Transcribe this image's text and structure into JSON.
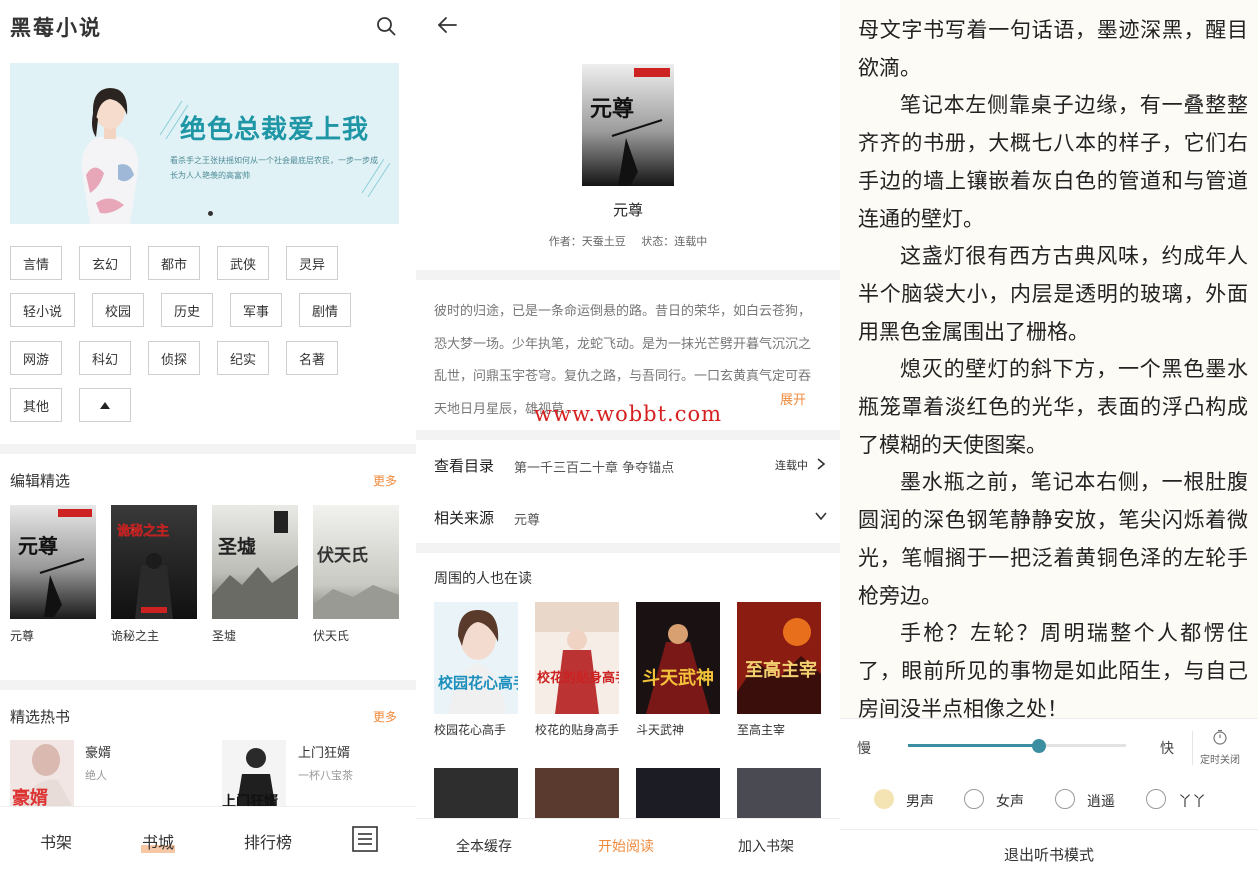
{
  "bookstore": {
    "app_title": "黑莓小说",
    "banner": {
      "title": "绝色总裁爱上我",
      "subtitle": "看杀手之王张扶摇如何从一个社会最底层农民，一步一步成长为人人艳羡的高富帅"
    },
    "categories": [
      "言情",
      "玄幻",
      "都市",
      "武侠",
      "灵异",
      "轻小说",
      "校园",
      "历史",
      "军事",
      "剧情",
      "网游",
      "科幻",
      "侦探",
      "纪实",
      "名著",
      "其他"
    ],
    "editor_picks": {
      "title": "编辑精选",
      "more": "更多",
      "books": [
        {
          "name": "元尊",
          "cover_text": "元尊"
        },
        {
          "name": "诡秘之主",
          "cover_text": "诡秘之主"
        },
        {
          "name": "圣墟",
          "cover_text": "圣墟"
        },
        {
          "name": "伏天氏",
          "cover_text": "伏天氏"
        }
      ]
    },
    "hot_books": {
      "title": "精选热书",
      "more": "更多",
      "books": [
        {
          "name": "豪婿",
          "author": "绝人",
          "cover_text": "豪婿"
        },
        {
          "name": "上门狂婿",
          "author": "一杯八宝茶",
          "cover_text": "上门狂婿"
        }
      ]
    },
    "bottom_nav": [
      "书架",
      "书城",
      "排行榜"
    ]
  },
  "detail": {
    "book_name": "元尊",
    "cover_text": "元尊",
    "author": "作者：天蚕土豆",
    "status": "状态：连载中",
    "intro": "彼时的归途，已是一条命运倒悬的路。昔日的荣华，如白云苍狗，恐大梦一场。少年执笔，龙蛇飞动。是为一抹光芒劈开暮气沉沉之乱世，问鼎玉宇苍穹。复仇之路，与吾同行。一口玄黄真气定可吞天地日月星辰，雄视草..",
    "intro_more": "展开",
    "catalog": {
      "label": "查看目录",
      "value": "第一千三百二十章 争夺锚点",
      "status": "连载中"
    },
    "source": {
      "label": "相关来源",
      "value": "元尊"
    },
    "also_reading": {
      "title": "周围的人也在读",
      "books": [
        {
          "name": "校园花心高手",
          "cover_text": "校园花心高手"
        },
        {
          "name": "校花的贴身高手",
          "cover_text": "校花的贴身高手"
        },
        {
          "name": "斗天武神",
          "cover_text": "斗天武神"
        },
        {
          "name": "至高主宰",
          "cover_text": "至高主宰"
        }
      ]
    },
    "actions": {
      "cache": "全本缓存",
      "read": "开始阅读",
      "shelf": "加入书架"
    },
    "watermark": "www.wobbt.com"
  },
  "reader": {
    "paragraphs": [
      "母文字书写着一句话语，墨迹深黑，醒目欲滴。",
      "笔记本左侧靠桌子边缘，有一叠整整齐齐的书册，大概七八本的样子，它们右手边的墙上镶嵌着灰白色的管道和与管道连通的壁灯。",
      "这盏灯很有西方古典风味，约成年人半个脑袋大小，内层是透明的玻璃，外面用黑色金属围出了栅格。",
      "熄灭的壁灯的斜下方，一个黑色墨水瓶笼罩着淡红色的光华，表面的浮凸构成了模糊的天使图案。",
      "墨水瓶之前，笔记本右侧，一根肚腹圆润的深色钢笔静静安放，笔尖闪烁着微光，笔帽搁于一把泛着黄铜色泽的左轮手枪旁边。",
      "手枪？左轮？周明瑞整个人都愣住了，眼前所见的事物是如此陌生，与自己房间没半点相像之处！"
    ],
    "listen": {
      "slow": "慢",
      "fast": "快",
      "speed": 0.6,
      "timer_label": "定时关闭",
      "voices": [
        {
          "label": "男声",
          "selected": true
        },
        {
          "label": "女声",
          "selected": false
        },
        {
          "label": "逍遥",
          "selected": false
        },
        {
          "label": "丫丫",
          "selected": false
        }
      ],
      "exit": "退出听书模式"
    }
  },
  "colors": {
    "accent": "#f08a3c",
    "teal": "#3b8fa1",
    "banner_bg": "#e1f2f6"
  }
}
